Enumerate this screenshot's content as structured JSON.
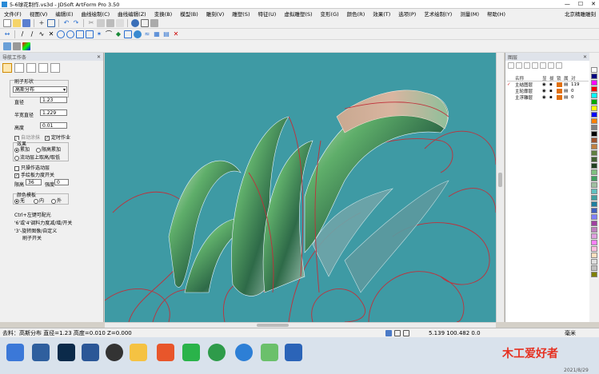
{
  "window": {
    "title": "5-6球花制作.vs3d - JDSoft ArtForm Pro 3.50",
    "buttons": [
      "—",
      "☐",
      "✕"
    ]
  },
  "menu": {
    "items": [
      "文件(F)",
      "视图(V)",
      "编辑(E)",
      "曲线绘制(C)",
      "曲线编辑(Z)",
      "变换(B)",
      "模型(B)",
      "雕刻(V)",
      "雕塑(S)",
      "特征(U)",
      "虚拟雕塑(S)",
      "变形(G)",
      "颜色(R)",
      "效果(T)",
      "选项(P)",
      "艺术绘制(Y)",
      "测量(M)",
      "帮助(H)"
    ],
    "right_label": "北京精雕雕刻"
  },
  "left_panel": {
    "header": "导航工作条",
    "brush_shape_label": "刷子形状",
    "brush_shape_value": "高斯分布",
    "diameter_label": "直径",
    "diameter_value": "1.23",
    "half_diameter_label": "半宽直径",
    "half_diameter_value": "1.229",
    "height_label": "高度",
    "height_value": "0.01",
    "auto_paint_label": "自动涂抹",
    "fixed_work_label": "定时作业",
    "effect_label": "效果",
    "effect_options": [
      "累加",
      "限高累加",
      "流动层上取高/取低"
    ],
    "only_edit_label": "只操作选动层",
    "pressure_label": "手绘板力度开关",
    "limit_height_label": "限高",
    "limit_height_value": "36",
    "strength_label": "强度",
    "strength_value": "0",
    "color_template_label": "颜色模板",
    "color_options": [
      "无",
      "内",
      "外"
    ],
    "hint_lines": [
      "Ctrl+左键可配光",
      "'6'或'4'调料力度减/增/开关",
      "'3'-旋转图像/自定义",
      "刷子开关"
    ]
  },
  "layers": {
    "header": "图层",
    "columns": [
      "名称",
      "显",
      "拔",
      "锁",
      "属",
      "对"
    ],
    "rows": [
      {
        "name": "主结图层",
        "count": "119",
        "color": "#e07010"
      },
      {
        "name": "主轮廓层",
        "count": "0",
        "color": "#e07010"
      },
      {
        "name": "主浮雕层",
        "count": "0",
        "color": "#e07010"
      }
    ]
  },
  "palette_colors": [
    "#ffffff",
    "#000080",
    "#ff00ff",
    "#ff0000",
    "#00ffff",
    "#00aa00",
    "#ffff00",
    "#0000ff",
    "#ff8000",
    "#808080",
    "#000000",
    "#a0522d",
    "#c08040",
    "#608040",
    "#406030",
    "#204020",
    "#80c080",
    "#40a060",
    "#a0c0a0",
    "#60c0c0",
    "#40a0a0",
    "#2080a0",
    "#4060c0",
    "#8080ff",
    "#a040a0",
    "#c080c0",
    "#e0a0e0",
    "#ff80ff",
    "#ffc0e0",
    "#ffe0c0",
    "#e0e0e0",
    "#c0c0c0",
    "#808000"
  ],
  "status": {
    "text": "去料：高斯分布  直径=1.23  高度=0.010  Z=0.000",
    "coords": "5.139  100.482  0.0",
    "unit": "毫米"
  },
  "taskbar": {
    "brand": "木工爱好者",
    "date": "2021/8/29"
  }
}
